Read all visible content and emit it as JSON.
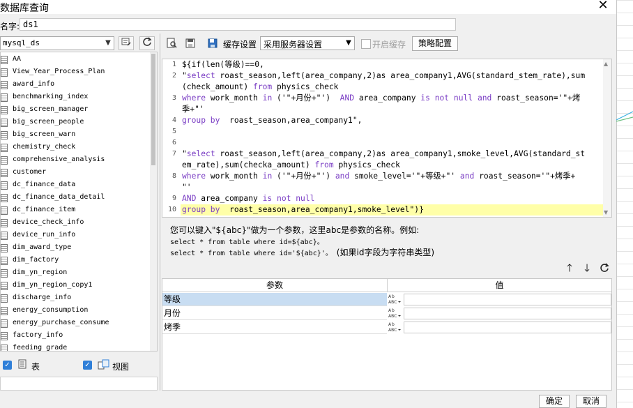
{
  "window": {
    "title": "数据库查询",
    "close_glyph": "✕"
  },
  "name_field": {
    "label": "名字:",
    "value": "ds1"
  },
  "datasource": {
    "selected": "mysql_ds"
  },
  "tables": [
    "AA",
    "View_Year_Process_Plan",
    "award_info",
    "benchmarking_index",
    "big_screen_manager",
    "big_screen_people",
    "big_screen_warn",
    "chemistry_check",
    "comprehensive_analysis",
    "customer",
    "dc_finance_data",
    "dc_finance_data_detail",
    "dc_finance_item",
    "device_check_info",
    "device_run_info",
    "dim_award_type",
    "dim_factory",
    "dim_yn_region",
    "dim_yn_region_copy1",
    "discharge_info",
    "energy_consumption",
    "energy_purchase_consume",
    "factory_info",
    "feeding_grade"
  ],
  "filters": {
    "tables_label": "表",
    "views_label": "视图"
  },
  "toolbar": {
    "cache_label": "缓存设置",
    "server_option": "采用服务器设置",
    "enable_cache_label": "开启缓存",
    "strategy_label": "策略配置"
  },
  "editor": {
    "line_numbers": [
      "1",
      "2",
      "3",
      "4",
      "5",
      "6",
      "7",
      "8",
      "9",
      "10"
    ],
    "lines": [
      "${if(len(等级)==0,",
      "\"select roast_season,left(area_company,2)as area_company1,AVG(standard_stem_rate),sum",
      "(check_amount) from physics_check",
      "where work_month in ('\"+月份+\"')  AND area_company is not null and roast_season='\"+烤",
      "季+\"'",
      "group by  roast_season,area_company1\",",
      "",
      "",
      "\"select roast_season,left(area_company,2)as area_company1,smoke_level,AVG(standard_st",
      "em_rate),sum(checka_amount) from physics_check",
      "where work_month in ('\"+月份+\"') and smoke_level='\"+等级+\"' and roast_season='\"+烤季+",
      "\"'",
      "AND area_company is not null",
      "group by  roast_season,area_company1,smoke_level\")}"
    ]
  },
  "hint": {
    "line1": "您可以键入\"${abc}\"做为一个参数，这里abc是参数的名称。例如:",
    "line2": "select * from table where id=${abc}。",
    "line3_code": "select * from table where id='${abc}'。",
    "line3_note": "(如果id字段为字符串类型)"
  },
  "params": {
    "header_name": "参数",
    "header_value": "值",
    "type_glyph_top": "A͏͏͏B͏͏U",
    "type_glyph_bottom": "ABC",
    "rows": [
      {
        "name": "等级",
        "value": ""
      },
      {
        "name": "月份",
        "value": ""
      },
      {
        "name": "烤季",
        "value": ""
      }
    ]
  },
  "buttons": {
    "ok": "确定",
    "cancel": "取消"
  },
  "icons": {
    "close": "close-icon",
    "refresh": "refresh-icon",
    "up": "arrow-up-icon",
    "down": "arrow-down-icon"
  }
}
